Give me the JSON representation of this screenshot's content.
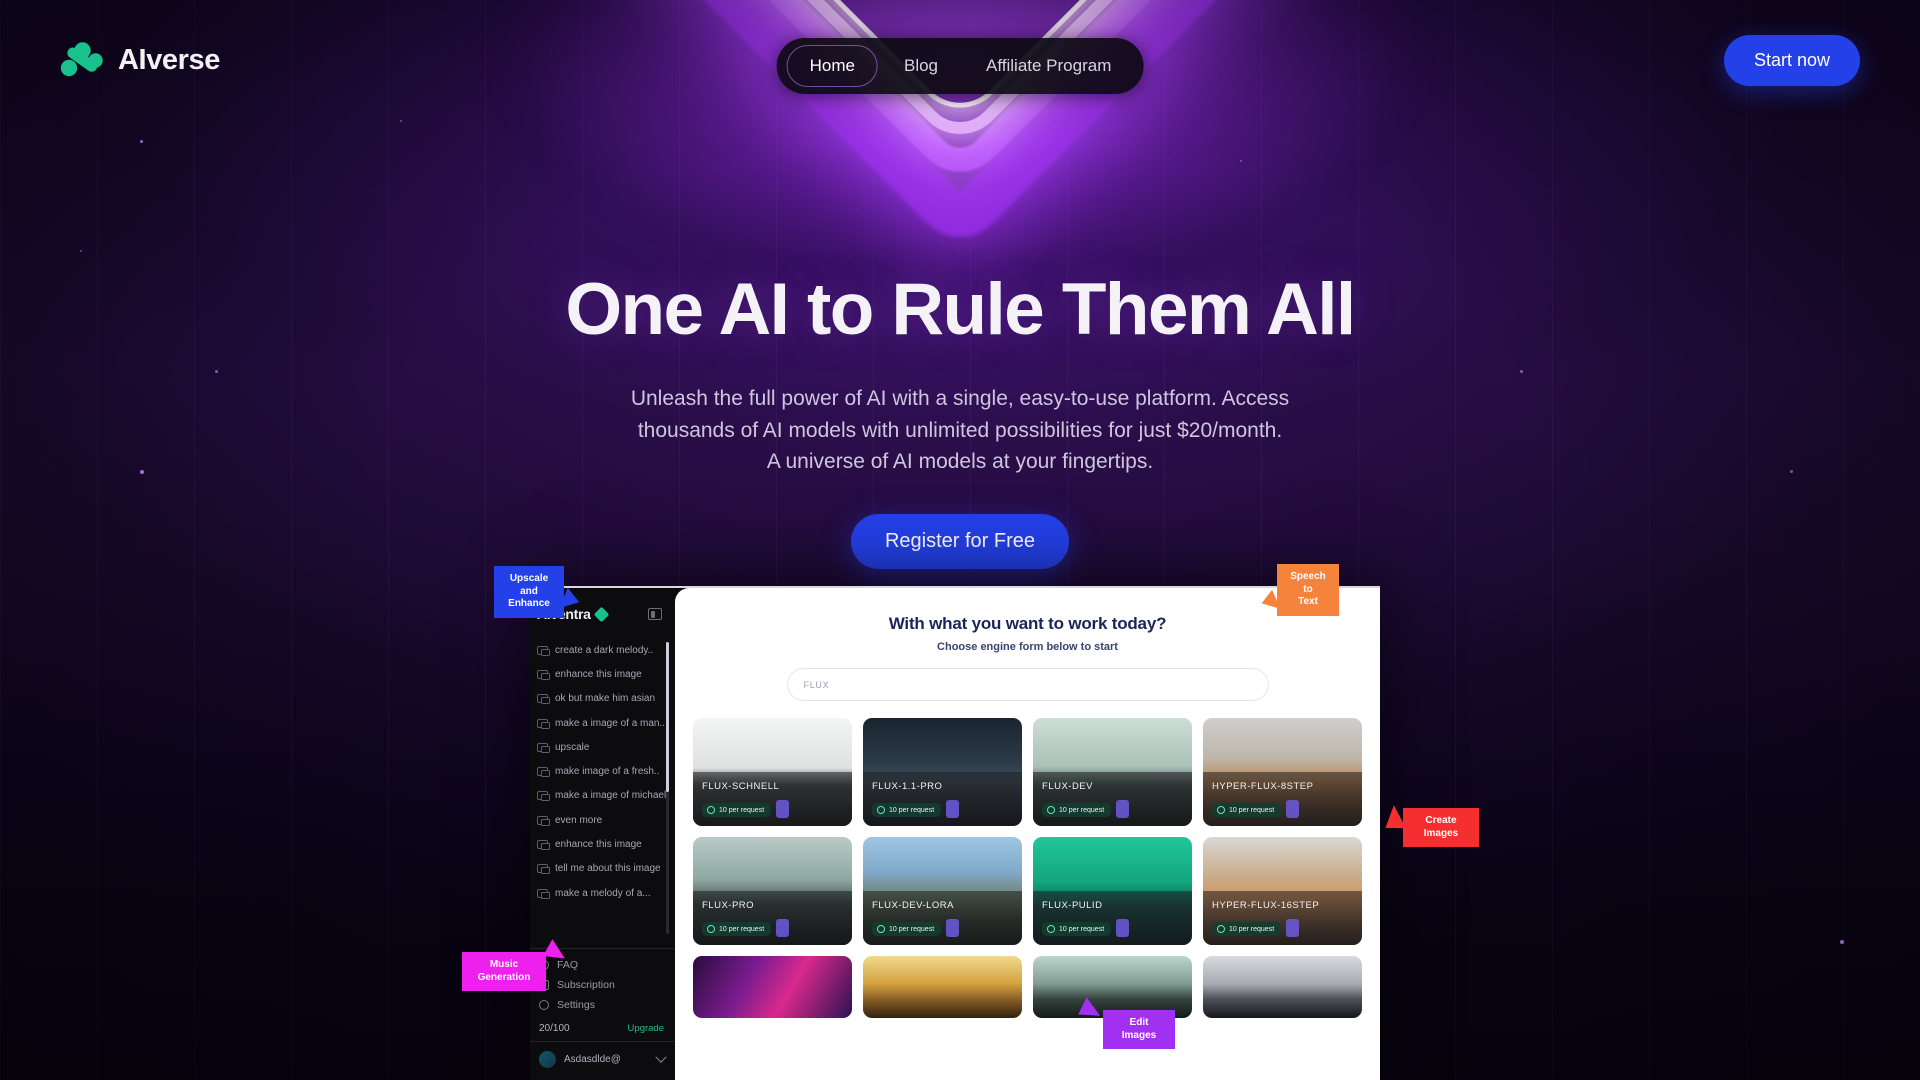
{
  "brand": {
    "name": "AIverse",
    "logo_icon": "aiverse-leaf-logo",
    "logo_color": "#19c28c"
  },
  "nav": {
    "items": [
      {
        "label": "Home",
        "active": true
      },
      {
        "label": "Blog",
        "active": false
      },
      {
        "label": "Affiliate Program",
        "active": false
      }
    ],
    "cta_label": "Start now",
    "cta_color": "#2440e8"
  },
  "hero": {
    "title": "One AI to Rule Them All",
    "subtitle": "Unleash the full power of AI with a single, easy-to-use platform. Access\nthousands of AI models with unlimited possibilities for just $20/month.\nA universe of AI models at your fingertips.",
    "cta_label": "Register for Free"
  },
  "mockup": {
    "sidebar": {
      "app_name": "AIventra",
      "panel_toggle_icon": "panel-collapse-icon",
      "chats": [
        "create a dark melody..",
        "enhance this image",
        "ok but make him asian",
        "make a image of a man..",
        "upscale",
        "make image of a fresh..",
        "make a image of michael",
        "even more",
        "enhance this image",
        "tell me about this image",
        "make a melody of a..."
      ],
      "links": [
        {
          "label": "FAQ",
          "icon": "question-circle-icon"
        },
        {
          "label": "Subscription",
          "icon": "card-icon"
        },
        {
          "label": "Settings",
          "icon": "gear-icon"
        }
      ],
      "credits_value": "20/100",
      "credits_icon": "coin-icon",
      "upgrade_label": "Upgrade",
      "user_name": "Asdasdlde@",
      "user_chevron_icon": "chevron-down-icon"
    },
    "main": {
      "heading": "With what you want to work today?",
      "subheading": "Choose engine form below to start",
      "search_value": "FLUX",
      "search_placeholder": "FLUX",
      "cards": [
        {
          "title": "FLUX-SCHNELL",
          "cost": "10 per request",
          "art": "img-schnell"
        },
        {
          "title": "FLUX-1.1-PRO",
          "cost": "10 per request",
          "art": "img-11pro"
        },
        {
          "title": "FLUX-DEV",
          "cost": "10 per request",
          "art": "img-dev"
        },
        {
          "title": "HYPER-FLUX-8STEP",
          "cost": "10 per request",
          "art": "img-dog"
        },
        {
          "title": "FLUX-PRO",
          "cost": "10 per request",
          "art": "img-pro"
        },
        {
          "title": "FLUX-DEV-LORA",
          "cost": "10 per request",
          "art": "img-lora"
        },
        {
          "title": "FLUX-PULID",
          "cost": "10 per request",
          "art": "img-pulid"
        },
        {
          "title": "HYPER-FLUX-16STEP",
          "cost": "10 per request",
          "art": "img-cat"
        }
      ],
      "cards_row3": [
        {
          "art": "img-neon"
        },
        {
          "art": "img-char"
        },
        {
          "art": "img-green2"
        },
        {
          "art": "img-repl"
        }
      ]
    }
  },
  "callouts": [
    {
      "label": "Upscale and\nEnhance",
      "color": "#2440e8"
    },
    {
      "label": "Speech to\nText",
      "color": "#f5833c"
    },
    {
      "label": "Create\nImages",
      "color": "#f52f2f"
    },
    {
      "label": "Music\nGeneration",
      "color": "#ee20ee"
    },
    {
      "label": "Edit\nImages",
      "color": "#a230f0"
    }
  ]
}
